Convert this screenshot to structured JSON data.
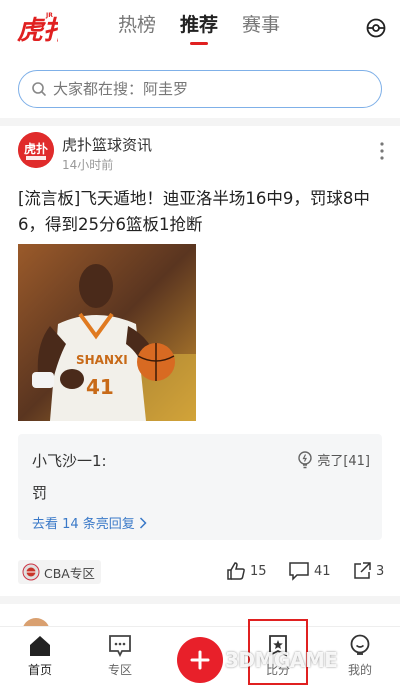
{
  "header": {
    "tabs": [
      {
        "label": "热榜",
        "active": false
      },
      {
        "label": "推荐",
        "active": true
      },
      {
        "label": "赛事",
        "active": false
      }
    ],
    "accent_color": "#e02020"
  },
  "search": {
    "placeholder": "大家都在搜：阿圭罗"
  },
  "post": {
    "source": "虎扑篮球资讯",
    "time": "14小时前",
    "title": "[流言板]飞天遁地！迪亚洛半场16中9，罚球8中6，得到25分6篮板1抢断",
    "comment": {
      "user": "小飞沙一1:",
      "light_label": "亮了[41]",
      "text": "罚",
      "more_label": "去看 14 条亮回复"
    },
    "zone_tag": "CBA专区",
    "actions": {
      "likes": "15",
      "comments": "41",
      "shares": "3"
    }
  },
  "bottom_nav": {
    "items": [
      {
        "label": "首页",
        "icon": "home-icon",
        "active": true
      },
      {
        "label": "专区",
        "icon": "zone-icon",
        "active": false
      },
      {
        "label": "",
        "icon": "plus-icon",
        "active": false
      },
      {
        "label": "比分",
        "icon": "score-icon",
        "active": false
      },
      {
        "label": "我的",
        "icon": "profile-icon",
        "active": false
      }
    ]
  },
  "watermark": "3DMGAME"
}
